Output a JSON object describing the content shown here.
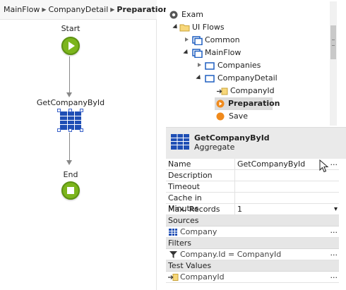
{
  "breadcrumb": {
    "items": [
      "MainFlow",
      "CompanyDetail"
    ],
    "current": "Preparation",
    "separator": "▶"
  },
  "flow": {
    "start_label": "Start",
    "aggregate_label": "GetCompanyById",
    "end_label": "End",
    "node_color": "#7cb51c"
  },
  "tree": {
    "items": [
      {
        "label": "Exam",
        "icon": "module-icon"
      },
      {
        "label": "UI Flows",
        "icon": "folder-icon"
      },
      {
        "label": "Common",
        "icon": "ui-flow-icon"
      },
      {
        "label": "MainFlow",
        "icon": "ui-flow-icon"
      },
      {
        "label": "Companies",
        "icon": "screen-icon"
      },
      {
        "label": "CompanyDetail",
        "icon": "screen-icon"
      },
      {
        "label": "CompanyId",
        "icon": "input-parameter-icon"
      },
      {
        "label": "Preparation",
        "icon": "preparation-icon",
        "selected": true
      },
      {
        "label": "Save",
        "icon": "action-icon"
      }
    ]
  },
  "properties": {
    "element_name": "GetCompanyById",
    "element_type": "Aggregate",
    "rows": [
      {
        "name": "Name",
        "value": "GetCompanyById",
        "ellipsis": "..."
      },
      {
        "name": "Description",
        "value": ""
      },
      {
        "name": "Timeout",
        "value": ""
      },
      {
        "name": "Cache in Minutes",
        "value": ""
      },
      {
        "name": "Max. Records",
        "value": "1",
        "dropdown": "▾"
      }
    ],
    "sections": {
      "sources": {
        "title": "Sources",
        "item": "Company",
        "ellipsis": "..."
      },
      "filters": {
        "title": "Filters",
        "item": "Company.Id = CompanyId",
        "ellipsis": "..."
      },
      "test_values": {
        "title": "Test Values",
        "item": "CompanyId",
        "ellipsis": "..."
      }
    }
  },
  "colors": {
    "accent_blue": "#1f4fb5",
    "green": "#7cb51c",
    "orange": "#f08a1c",
    "selected_bg": "#dcdcdc"
  }
}
